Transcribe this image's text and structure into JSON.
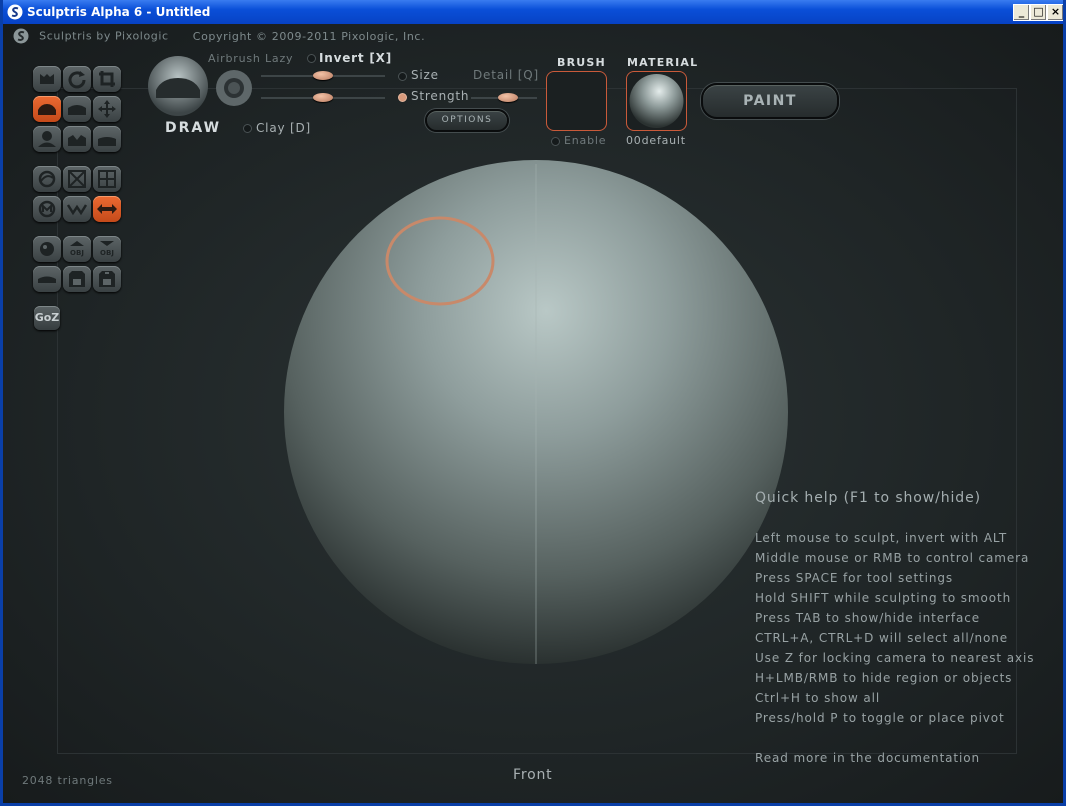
{
  "window": {
    "title": "Sculptris Alpha 6 - Untitled",
    "controls": {
      "minimize": "_",
      "maximize": "□",
      "close": "×"
    }
  },
  "app_header": {
    "name": "Sculptris by Pixologic",
    "copyright": "Copyright © 2009-2011 Pixologic, Inc."
  },
  "toolbar": {
    "tool_name": "DRAW",
    "airbrush_label": "Airbrush",
    "lazy_label": "Lazy",
    "invert_label": "Invert [X]",
    "size_label": "Size",
    "strength_label": "Strength",
    "detail_label": "Detail [Q]",
    "clay_label": "Clay [D]",
    "options_label": "OPTIONS",
    "brush_title": "BRUSH",
    "brush_enable_label": "Enable",
    "material_title": "MATERIAL",
    "material_name": "00default",
    "paint_label": "PAINT"
  },
  "tools": {
    "grid_rows": [
      [
        "crease-icon",
        "rotate-icon",
        "crop-icon"
      ],
      [
        "draw-icon",
        "flatten-icon",
        "move-icon"
      ],
      [
        "inflate-icon",
        "pinch-icon",
        "smooth-icon"
      ]
    ],
    "secondary_rows": [
      [
        "symmetry-icon",
        "wireframe-icon",
        "grid-icon"
      ],
      [
        "mask-icon",
        "reduce-icon",
        "symmetry-axis-icon"
      ],
      [
        "sphere-icon",
        "obj-import-icon",
        "obj-export-icon"
      ],
      [
        "plane-icon",
        "save-icon",
        "save-as-icon"
      ]
    ],
    "goz_label": "GoZ",
    "active": [
      "draw-icon",
      "symmetry-axis-icon"
    ]
  },
  "viewport": {
    "view_name": "Front",
    "triangle_count": "2048 triangles"
  },
  "quick_help": {
    "title": "Quick help (F1 to show/hide)",
    "lines": [
      "Left mouse to sculpt, invert with ALT",
      "Middle mouse or RMB to control camera",
      "Press SPACE for tool settings",
      "Hold SHIFT while sculpting to smooth",
      "Press TAB to show/hide interface",
      "CTRL+A, CTRL+D will select all/none",
      "Use Z for locking camera to nearest axis",
      "H+LMB/RMB to hide region or objects",
      "Ctrl+H to show all",
      "Press/hold P to toggle or place pivot"
    ],
    "more": "Read more in the documentation"
  },
  "colors": {
    "accent": "#e0622c",
    "brush_cursor": "#c8896a",
    "sphere": "#8e9d9c"
  }
}
